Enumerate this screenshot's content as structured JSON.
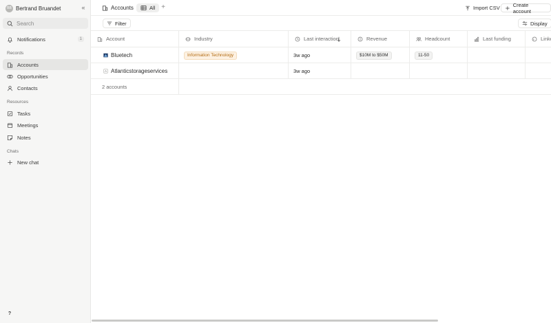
{
  "sidebar": {
    "user": {
      "initials": "BB",
      "name": "Bertrand Bruandet"
    },
    "search_placeholder": "Search",
    "notifications": {
      "label": "Notifications",
      "count": "1"
    },
    "records_label": "Records",
    "records": [
      {
        "label": "Accounts",
        "icon": "building-icon",
        "active": true
      },
      {
        "label": "Opportunities",
        "icon": "target-icon",
        "active": false
      },
      {
        "label": "Contacts",
        "icon": "user-icon",
        "active": false
      }
    ],
    "resources_label": "Resources",
    "resources": [
      {
        "label": "Tasks",
        "icon": "checkbox-icon"
      },
      {
        "label": "Meetings",
        "icon": "calendar-icon"
      },
      {
        "label": "Notes",
        "icon": "note-icon"
      }
    ],
    "chats_label": "Chats",
    "new_chat": "New chat",
    "help": "?"
  },
  "topbar": {
    "breadcrumb": "Accounts",
    "view_tab": "All",
    "add_view": "+",
    "import_label": "Import CSV",
    "create_label": "Create account"
  },
  "toolbar": {
    "filter_label": "Filter",
    "display_label": "Display"
  },
  "table": {
    "columns": [
      "Account",
      "Industry",
      "Last interaction",
      "Revenue",
      "Headcount",
      "Last funding",
      "Linked"
    ],
    "rows": [
      {
        "account": "Bluetech",
        "industry": "Information Technology",
        "last_interaction": "3w ago",
        "revenue": "$10M to $50M",
        "headcount": "11-50",
        "last_funding": "",
        "linked": ""
      },
      {
        "account": "Atlanticstorageservices",
        "logo_letter": "A",
        "industry": "",
        "last_interaction": "3w ago",
        "revenue": "",
        "headcount": "",
        "last_funding": "",
        "linked": ""
      }
    ],
    "footer": "2 accounts"
  },
  "colors": {
    "industry_chip_text": "#b26a10",
    "industry_chip_bg": "#fdf1e2"
  }
}
